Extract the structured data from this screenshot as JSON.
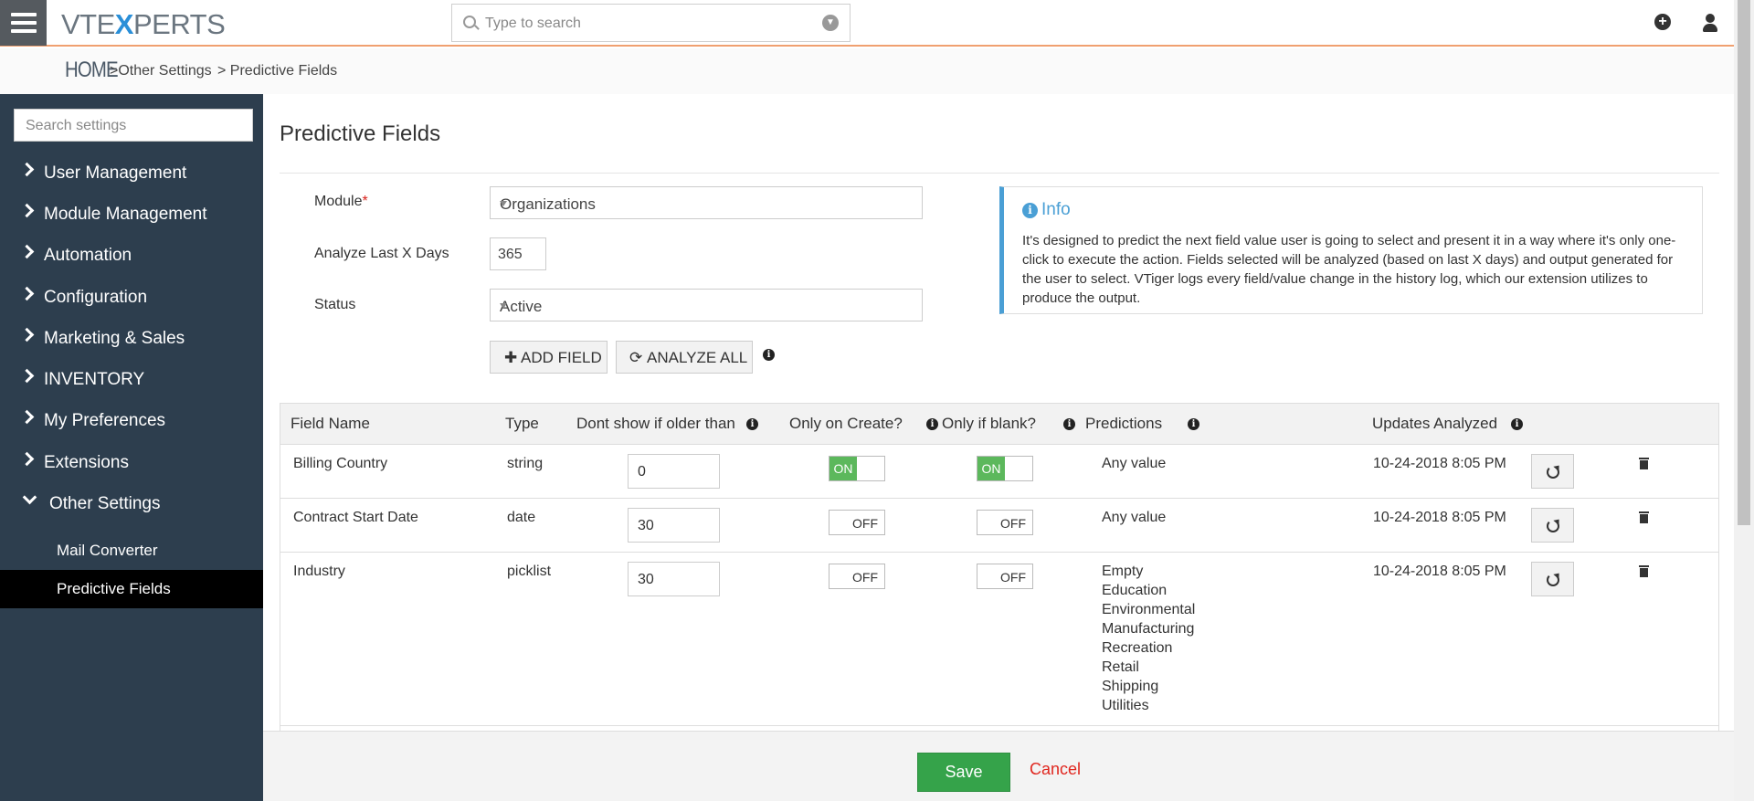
{
  "header": {
    "logo_prefix": "VTE",
    "logo_x": "X",
    "logo_suffix": "PERTS",
    "search_placeholder": "Type to search"
  },
  "breadcrumb": {
    "home": "HOME",
    "crumb1": "Other Settings",
    "crumb2": "Predictive Fields"
  },
  "sidebar": {
    "search_placeholder": "Search settings",
    "items": [
      {
        "label": "User Management"
      },
      {
        "label": "Module Management"
      },
      {
        "label": "Automation"
      },
      {
        "label": "Configuration"
      },
      {
        "label": "Marketing & Sales"
      },
      {
        "label": "INVENTORY"
      },
      {
        "label": "My Preferences"
      },
      {
        "label": "Extensions"
      },
      {
        "label": "Other Settings"
      }
    ],
    "subitems": [
      {
        "label": "Mail Converter"
      },
      {
        "label": "Predictive Fields"
      }
    ]
  },
  "page": {
    "title": "Predictive Fields",
    "module_label": "Module",
    "module_required": "*",
    "module_value": "Organizations",
    "days_label": "Analyze Last X Days",
    "days_value": "365",
    "status_label": "Status",
    "status_value": "Active",
    "add_field_label": "ADD FIELD",
    "analyze_all_label": "ANALYZE ALL"
  },
  "info": {
    "title": "Info",
    "text": "It's designed to predict the next field value user is going to select and present it in a way where it's only one-click to execute the action. Fields selected will be analyzed (based on last X days) and output generated for the user to select. VTiger logs every field/value change in the history log, which our extension utilizes to produce the output."
  },
  "table": {
    "headers": {
      "field_name": "Field Name",
      "type": "Type",
      "older_than": "Dont show if older than",
      "only_create": "Only on Create?",
      "only_blank": "Only if blank?",
      "predictions": "Predictions",
      "updates": "Updates Analyzed"
    },
    "toggle_on": "ON",
    "toggle_off": "OFF",
    "rows": [
      {
        "field": "Billing Country",
        "type": "string",
        "older": "0",
        "only_create": "ON",
        "only_blank": "ON",
        "predictions": [
          "Any value"
        ],
        "updated": "10-24-2018 8:05 PM"
      },
      {
        "field": "Contract Start Date",
        "type": "date",
        "older": "30",
        "only_create": "OFF",
        "only_blank": "OFF",
        "predictions": [
          "Any value"
        ],
        "updated": "10-24-2018 8:05 PM"
      },
      {
        "field": "Industry",
        "type": "picklist",
        "older": "30",
        "only_create": "OFF",
        "only_blank": "OFF",
        "predictions": [
          "Empty",
          "Education",
          "Environmental",
          "Manufacturing",
          "Recreation",
          "Retail",
          "Shipping",
          "Utilities"
        ],
        "updated": "10-24-2018 8:05 PM"
      }
    ]
  },
  "footer": {
    "save_label": "Save",
    "cancel_label": "Cancel"
  },
  "colors": {
    "sidebar_bg": "#2d3e4e",
    "accent_orange": "#f0a070",
    "info_blue": "#4a9fd5",
    "toggle_on_green": "#5cb85c",
    "save_green": "#35a34a",
    "cancel_red": "#e0271f"
  }
}
